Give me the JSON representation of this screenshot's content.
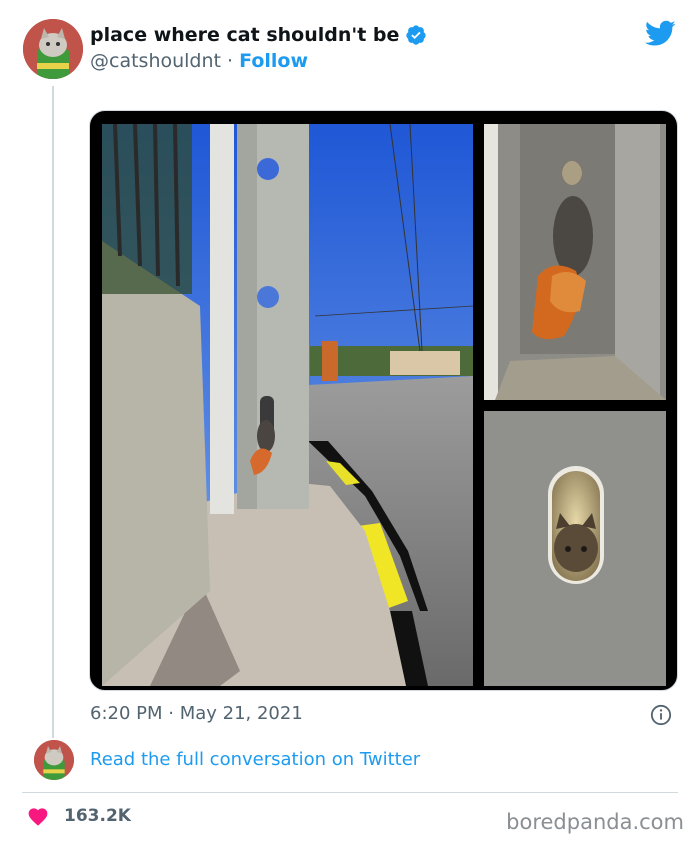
{
  "tweet": {
    "display_name": "place where cat shouldn't be",
    "handle": "@catshouldnt",
    "separator": "·",
    "follow_label": "Follow",
    "timestamp": "6:20 PM · May 21, 2021",
    "read_more_label": "Read the full conversation on Twitter",
    "like_count": "163.2K"
  },
  "icons": {
    "verified": "verified-badge-icon",
    "platform": "twitter-bird-icon",
    "info": "info-icon",
    "like": "heart-icon"
  },
  "colors": {
    "accent": "#1d9bf0",
    "like": "#f91880",
    "muted": "#536471"
  },
  "watermark": "boredpanda.com"
}
